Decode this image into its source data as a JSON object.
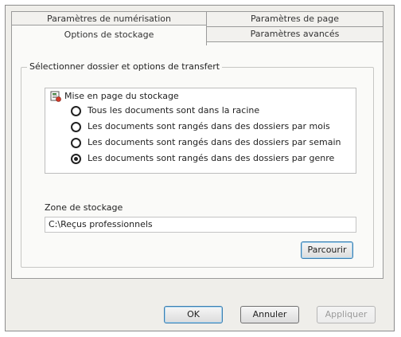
{
  "tabs": {
    "back_row": [
      "Paramètres de numérisation",
      "Paramètres de page"
    ],
    "front_row": [
      "Options de stockage",
      "Paramètres avancés"
    ]
  },
  "group": {
    "title": "Sélectionner dossier et options de transfert",
    "tree_root_label": "Mise en page du stockage",
    "options": [
      {
        "label": "Tous les documents sont dans la racine",
        "checked": false
      },
      {
        "label": "Les documents sont rangés dans des dossiers par mois",
        "checked": false
      },
      {
        "label": "Les documents sont rangés dans des dossiers par semain",
        "checked": false
      },
      {
        "label": "Les documents sont rangés dans des dossiers par genre",
        "checked": true
      }
    ]
  },
  "storage": {
    "zone_label": "Zone de stockage",
    "path_value": "C:\\Reçus professionnels",
    "browse_label": "Parcourir"
  },
  "footer": {
    "ok_label": "OK",
    "cancel_label": "Annuler",
    "apply_label": "Appliquer"
  },
  "icons": {
    "tree_root": "storage-layout-icon"
  }
}
